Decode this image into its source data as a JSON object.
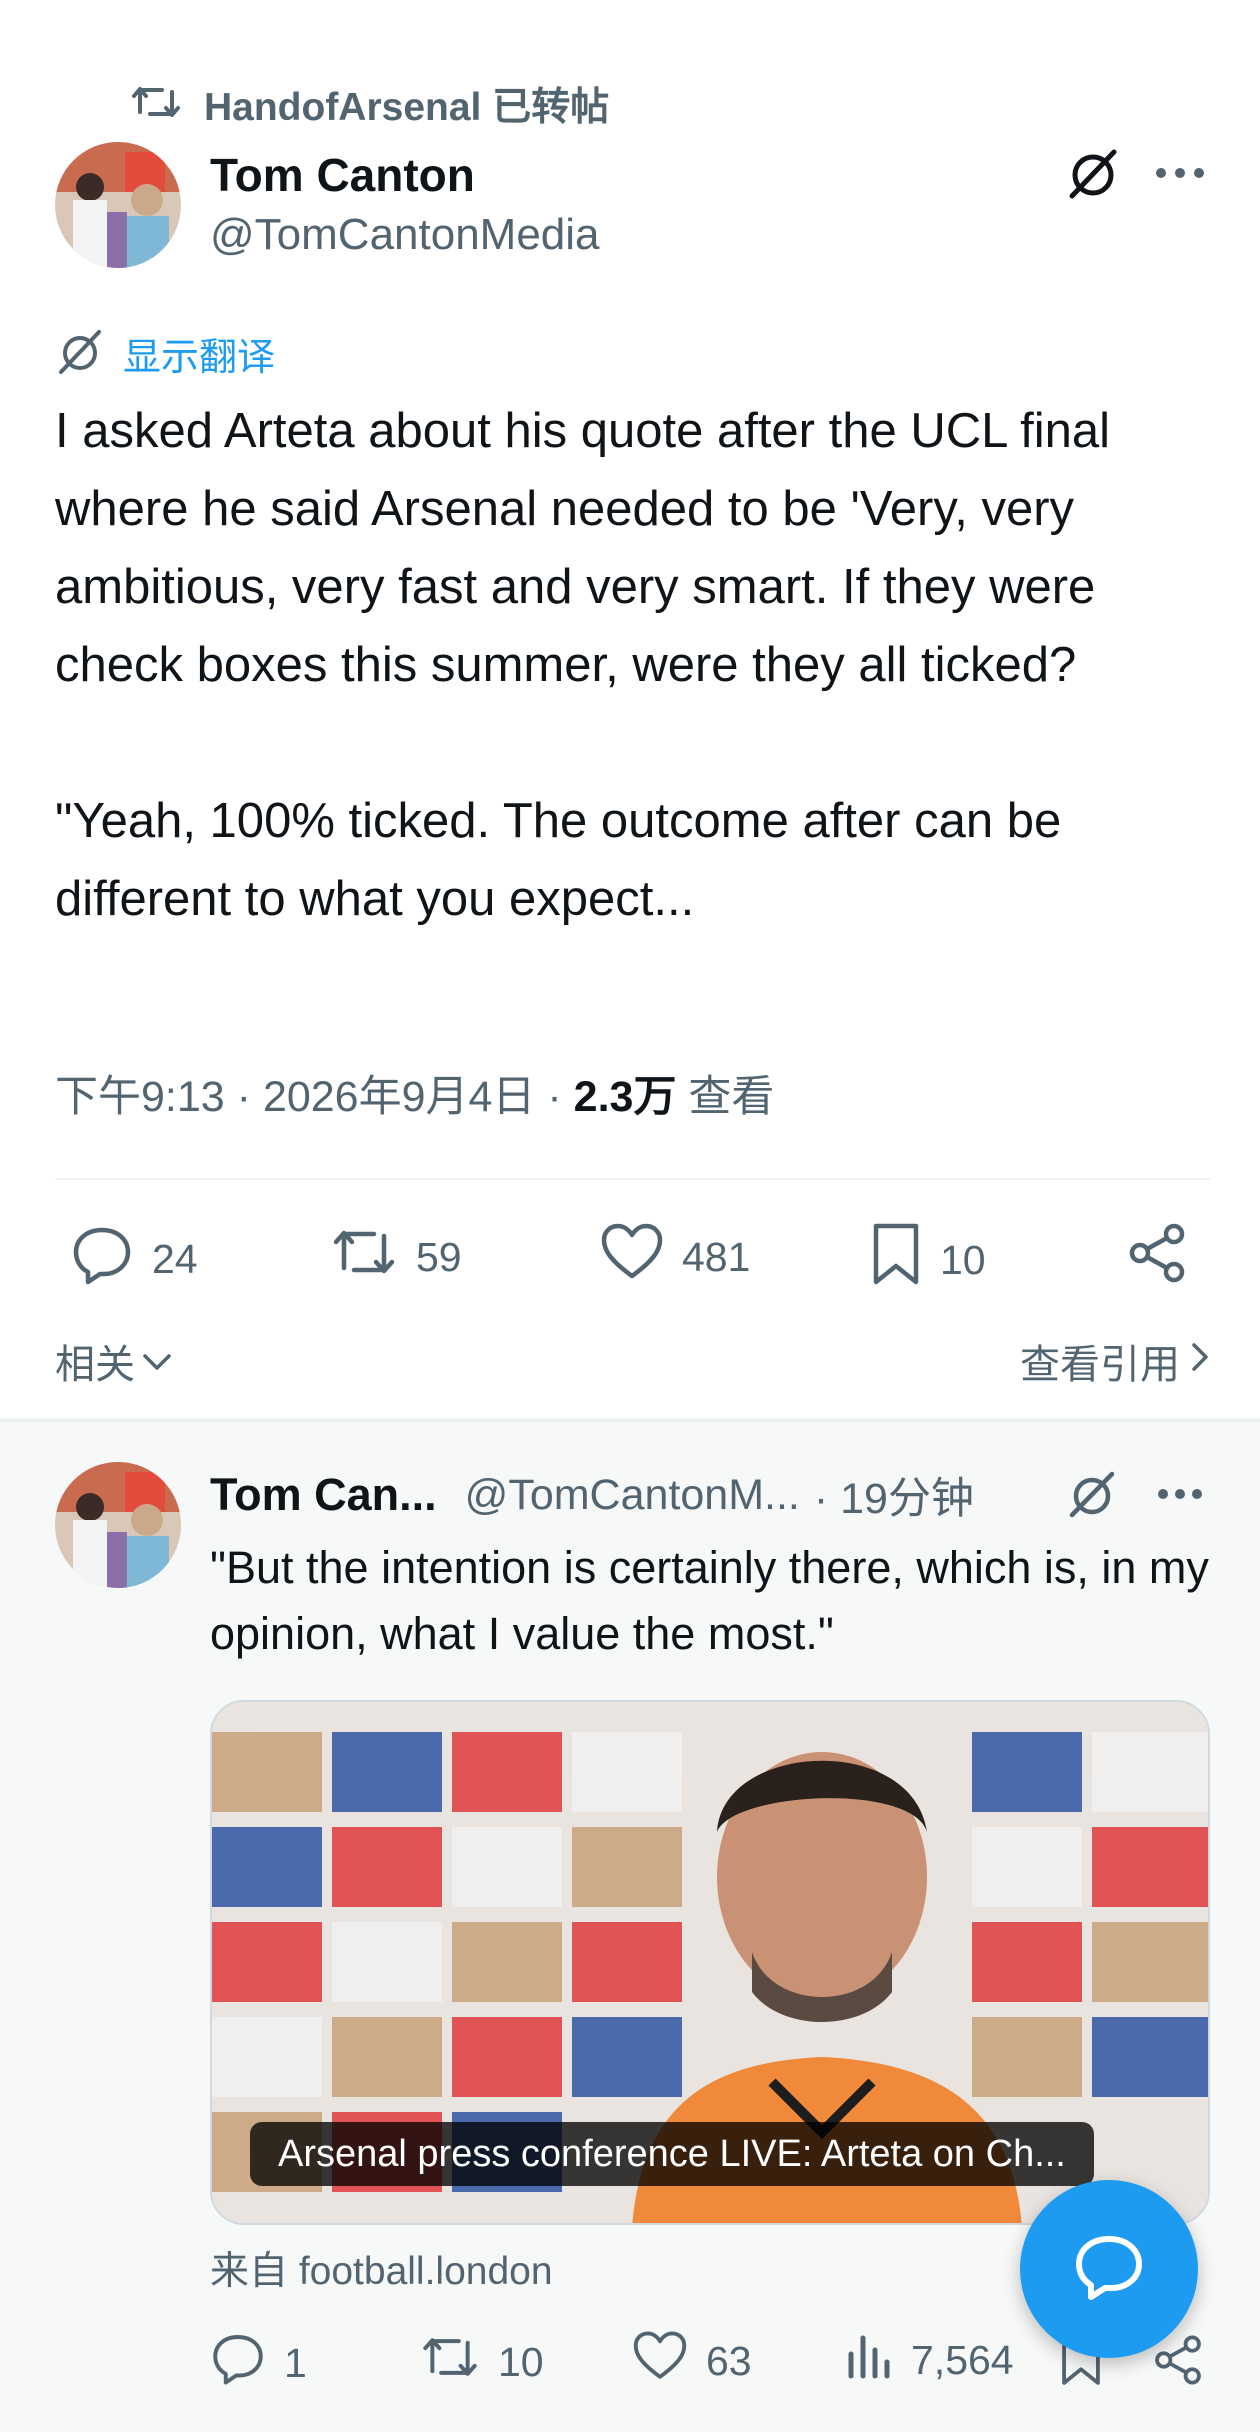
{
  "repost": {
    "label": "HandofArsenal 已转帖",
    "icon": "repost-icon"
  },
  "author": {
    "name": "Tom Canton",
    "handle": "@TomCantonMedia"
  },
  "translate_label": "显示翻译",
  "tweet_text": "I asked Arteta about his quote after the UCL final where he said Arsenal needed to be 'Very, very ambitious, very fast and very smart. If they were check boxes this summer, were they all ticked?\n\n\"Yeah, 100% ticked. The outcome after can be different to what you expect...",
  "meta": {
    "time": "下午9:13",
    "date": "2026年9月4日",
    "views_count": "2.3万",
    "views_label": "查看"
  },
  "actions": {
    "replies": "24",
    "reposts": "59",
    "likes": "481",
    "bookmarks": "10"
  },
  "related_label": "相关",
  "view_quotes_label": "查看引用",
  "reply": {
    "name": "Tom Can...",
    "handle": "@TomCantonM...",
    "time": "· 19分钟",
    "text": "\"But the intention is certainly there, which is, in my opinion, what I value the most.\"",
    "card_title": "Arsenal press conference LIVE: Arteta on Ch...",
    "card_source": "来自 football.london",
    "actions": {
      "replies": "1",
      "reposts": "10",
      "likes": "63",
      "views": "7,564"
    }
  },
  "colors": {
    "accent": "#1d9bf0",
    "text": "#0f1419",
    "muted": "#536471",
    "band": "#f7f9f9"
  }
}
